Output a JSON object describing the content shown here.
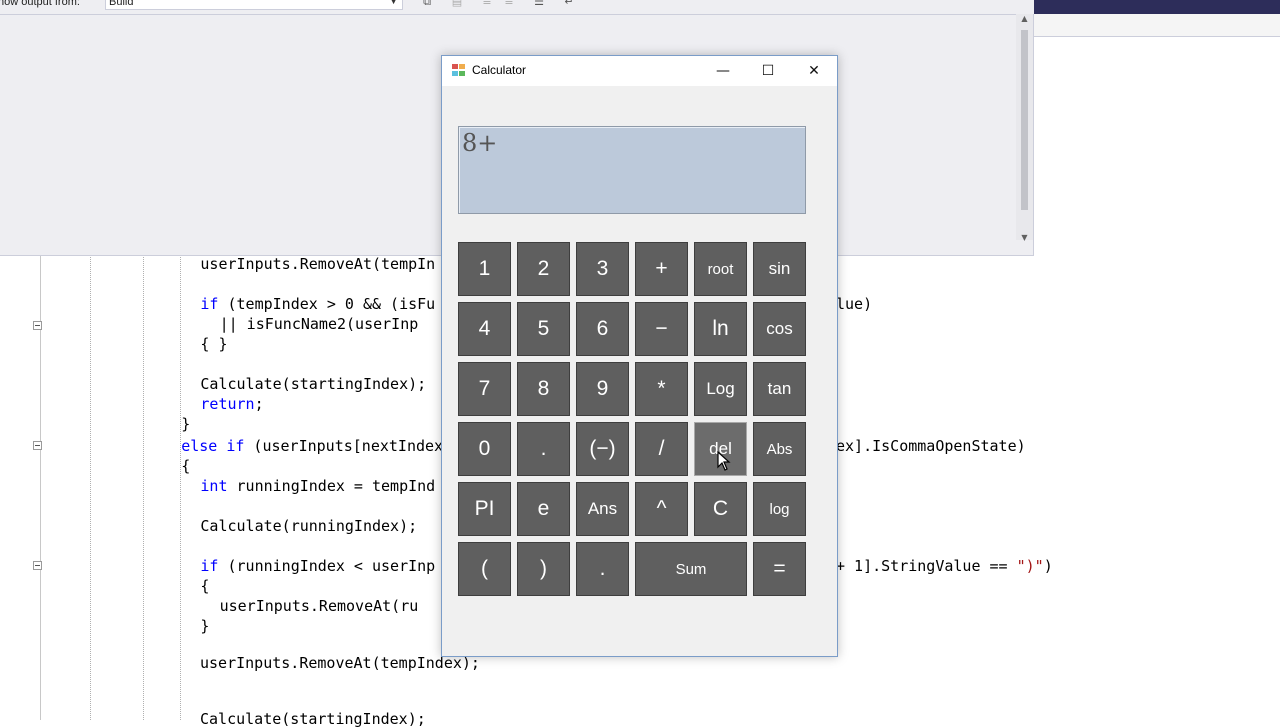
{
  "output_panel": {
    "label": "how output from:",
    "select_value": "Build",
    "toolbar_icons": [
      "copy-icon",
      "find-icon",
      "align-left-icon",
      "align-right-icon",
      "list-icon",
      "word-wrap-icon"
    ]
  },
  "code": {
    "lines": [
      {
        "indent": "        ",
        "parts": [
          {
            "t": "userInputs.RemoveAt(tempIn",
            "c": ""
          }
        ]
      },
      {
        "indent": "",
        "parts": []
      },
      {
        "indent": "        ",
        "parts": [
          {
            "t": "if",
            "c": "kw"
          },
          {
            "t": " (tempIndex > 0 && (isFu",
            "c": ""
          }
        ]
      },
      {
        "indent": "            ",
        "parts": [
          {
            "t": "|| isFuncName2(userInp",
            "c": ""
          }
        ]
      },
      {
        "indent": "        ",
        "parts": [
          {
            "t": "{ }",
            "c": ""
          }
        ]
      },
      {
        "indent": "",
        "parts": []
      },
      {
        "indent": "        ",
        "parts": [
          {
            "t": "Calculate(startingIndex);",
            "c": ""
          }
        ]
      },
      {
        "indent": "        ",
        "parts": [
          {
            "t": "return",
            "c": "kw"
          },
          {
            "t": ";",
            "c": ""
          }
        ]
      },
      {
        "indent": "    ",
        "parts": [
          {
            "t": "}",
            "c": ""
          }
        ]
      },
      {
        "indent": "    ",
        "parts": [
          {
            "t": "else",
            "c": "kw"
          },
          {
            "t": " ",
            "c": ""
          },
          {
            "t": "if",
            "c": "kw"
          },
          {
            "t": " (userInputs[nextIndex]",
            "c": ""
          }
        ]
      },
      {
        "indent": "    ",
        "parts": [
          {
            "t": "{",
            "c": ""
          }
        ]
      },
      {
        "indent": "        ",
        "parts": [
          {
            "t": "int",
            "c": "kw"
          },
          {
            "t": " runningIndex = tempInd",
            "c": ""
          }
        ]
      },
      {
        "indent": "",
        "parts": []
      },
      {
        "indent": "        ",
        "parts": [
          {
            "t": "Calculate(runningIndex);",
            "c": ""
          }
        ]
      },
      {
        "indent": "",
        "parts": []
      },
      {
        "indent": "        ",
        "parts": [
          {
            "t": "if",
            "c": "kw"
          },
          {
            "t": " (runningIndex < userInp",
            "c": ""
          }
        ]
      },
      {
        "indent": "        ",
        "parts": [
          {
            "t": "{",
            "c": ""
          }
        ]
      },
      {
        "indent": "            ",
        "parts": [
          {
            "t": "userInputs.RemoveAt(ru",
            "c": ""
          }
        ]
      },
      {
        "indent": "        ",
        "parts": [
          {
            "t": "}",
            "c": ""
          }
        ]
      }
    ],
    "right_fragments": {
      "line3": "lue)",
      "line10": "ex].IsCommaOpenState)",
      "line16_a": "+ 1].StringValue == ",
      "line16_str": "\")\"",
      "line16_b": ")"
    },
    "bottom_lines": {
      "remove_temp": "userInputs.RemoveAt(tempIndex);",
      "calc_start": "Calculate(startingIndex);"
    }
  },
  "calculator": {
    "title": "Calculator",
    "display": "8+",
    "window_controls": {
      "minimize": "—",
      "maximize": "☐",
      "close": "✕"
    },
    "keys": [
      [
        "1",
        "2",
        "3",
        "+",
        "root",
        "sin"
      ],
      [
        "4",
        "5",
        "6",
        "−",
        "ln",
        "cos"
      ],
      [
        "7",
        "8",
        "9",
        "*",
        "Log",
        "tan"
      ],
      [
        "0",
        ".",
        "(−)",
        "/",
        "del",
        "Abs"
      ],
      [
        "PI",
        "e",
        "Ans",
        "^",
        "C",
        "log"
      ],
      [
        "(",
        ")",
        ".",
        "Sum",
        "="
      ]
    ],
    "hovered_key": "del"
  }
}
